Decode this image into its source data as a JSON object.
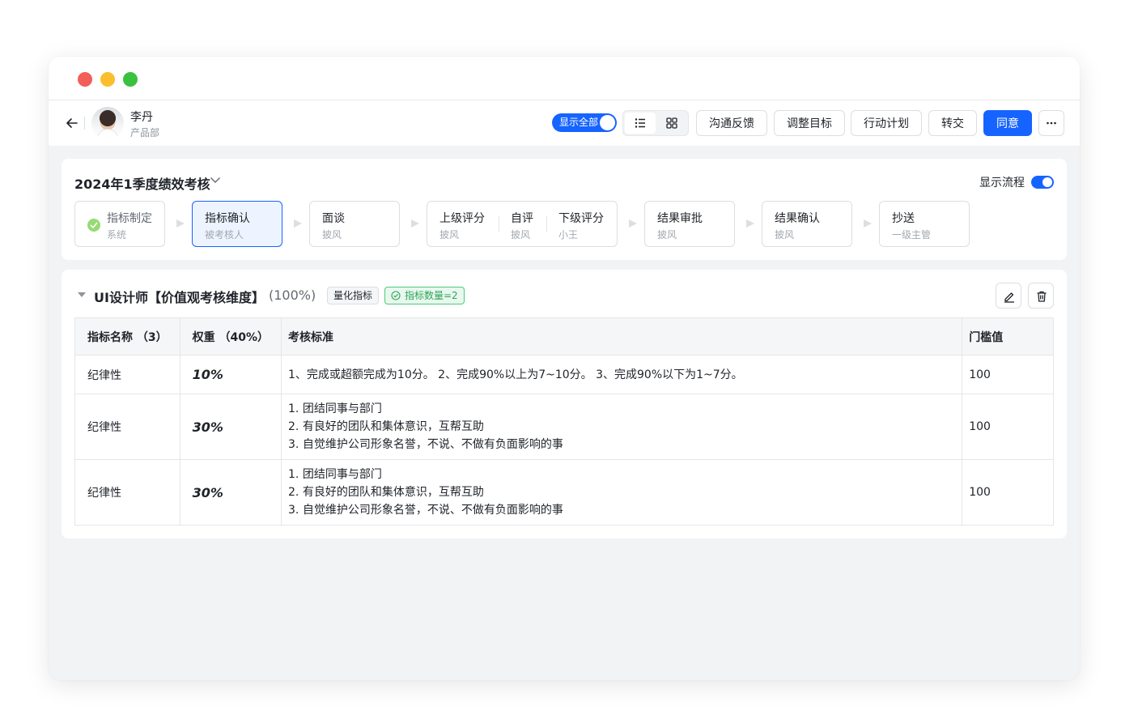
{
  "header": {
    "user_name": "李丹",
    "user_dept": "产品部",
    "show_all_label": "显示全部",
    "buttons": [
      "沟通反馈",
      "调整目标",
      "行动计划",
      "转交"
    ],
    "primary_button": "同意"
  },
  "process": {
    "title": "2024年1季度绩效考核",
    "show_flow_label": "显示流程",
    "steps": [
      {
        "name": "指标制定",
        "sub": "系统",
        "status": "done"
      },
      {
        "name": "指标确认",
        "sub": "被考核人",
        "status": "active"
      },
      {
        "name": "面谈",
        "sub": "披风",
        "status": "pending"
      },
      {
        "name": "上级评分",
        "sub": "披风",
        "status": "pending"
      },
      {
        "name": "自评",
        "sub": "披风",
        "status": "pending"
      },
      {
        "name": "下级评分",
        "sub": "小王",
        "status": "pending"
      },
      {
        "name": "结果审批",
        "sub": "披风",
        "status": "pending"
      },
      {
        "name": "结果确认",
        "sub": "披风",
        "status": "pending"
      },
      {
        "name": "抄送",
        "sub": "一级主管",
        "status": "pending"
      }
    ]
  },
  "dimension": {
    "title": "UI设计师【价值观考核维度】",
    "percent": "(100%)",
    "tag_type": "量化指标",
    "tag_count": "指标数量=2",
    "columns": [
      "指标名称 （3）",
      "权重 （40%）",
      "考核标准",
      "门槛值"
    ],
    "rows": [
      {
        "name": "纪律性",
        "weight": "10%",
        "criteria": [
          "1、完成或超额完成为10分。 2、完成90%以上为7~10分。 3、完成90%以下为1~7分。"
        ],
        "threshold": "100"
      },
      {
        "name": "纪律性",
        "weight": "30%",
        "criteria": [
          "1. 团结同事与部门",
          "2. 有良好的团队和集体意识，互帮互助",
          "3. 自觉维护公司形象名誉，不说、不做有负面影响的事"
        ],
        "threshold": "100"
      },
      {
        "name": "纪律性",
        "weight": "30%",
        "criteria": [
          "1. 团结同事与部门",
          "2. 有良好的团队和集体意识，互帮互助",
          "3. 自觉维护公司形象名誉，不说、不做有负面影响的事"
        ],
        "threshold": "100"
      }
    ]
  },
  "colors": {
    "primary": "#1664ff",
    "success": "#4ccb7a",
    "background": "#f2f3f5"
  },
  "icons": [
    "back-arrow-icon",
    "list-view-icon",
    "grid-view-icon",
    "more-icon",
    "chevron-down-icon",
    "check-circle-icon",
    "caret-down-icon",
    "edit-icon",
    "delete-icon"
  ]
}
